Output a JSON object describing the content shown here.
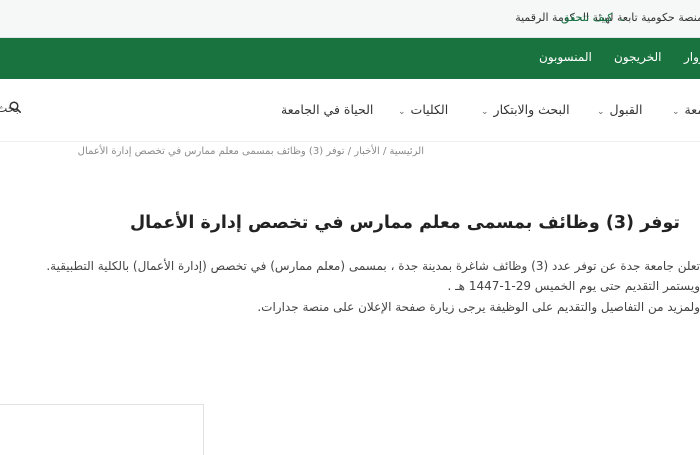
{
  "gov_bar": {
    "text": "منصة حكومية تابعة لهيئة الحكومة الرقمية",
    "verify_link": "كيف تتحقق",
    "chevron": "⌄"
  },
  "green_nav": {
    "items": [
      "المنسوبون",
      "الخريجون",
      "الزوار"
    ]
  },
  "main_nav": {
    "items": [
      {
        "label": "الحياة في الجامعة",
        "has_dropdown": false
      },
      {
        "label": "الكليات",
        "has_dropdown": true
      },
      {
        "label": "البحث والابتكار",
        "has_dropdown": true
      },
      {
        "label": "القبول",
        "has_dropdown": true
      },
      {
        "label": "الجامعة",
        "has_dropdown": true
      }
    ],
    "search_label": "بحث",
    "chevron": "⌄"
  },
  "breadcrumb": "الرئيسية / الأخبار / توفر (3) وظائف بمسمى معلم ممارس في تخصص إدارة الأعمال",
  "article": {
    "title": "توفر (3) وظائف بمسمى معلم ممارس في تخصص إدارة الأعمال",
    "lines": [
      "تعلن جامعة جدة عن توفر عدد (3) وظائف شاغرة بمدينة جدة ، بمسمى (معلم ممارس) في تخصص (إدارة الأعمال) بالكلية التطبيقية.",
      "ويستمر التقديم حتى يوم الخميس 29-1-1447 هـ .",
      "ولمزيد من التفاصيل والتقديم على الوظيفة يرجى زيارة صفحة الإعلان على منصة جدارات."
    ]
  },
  "colors": {
    "brand_green": "#19733f",
    "gov_bar_bg": "#f6f7f7",
    "link_green": "#1b7a4a"
  }
}
